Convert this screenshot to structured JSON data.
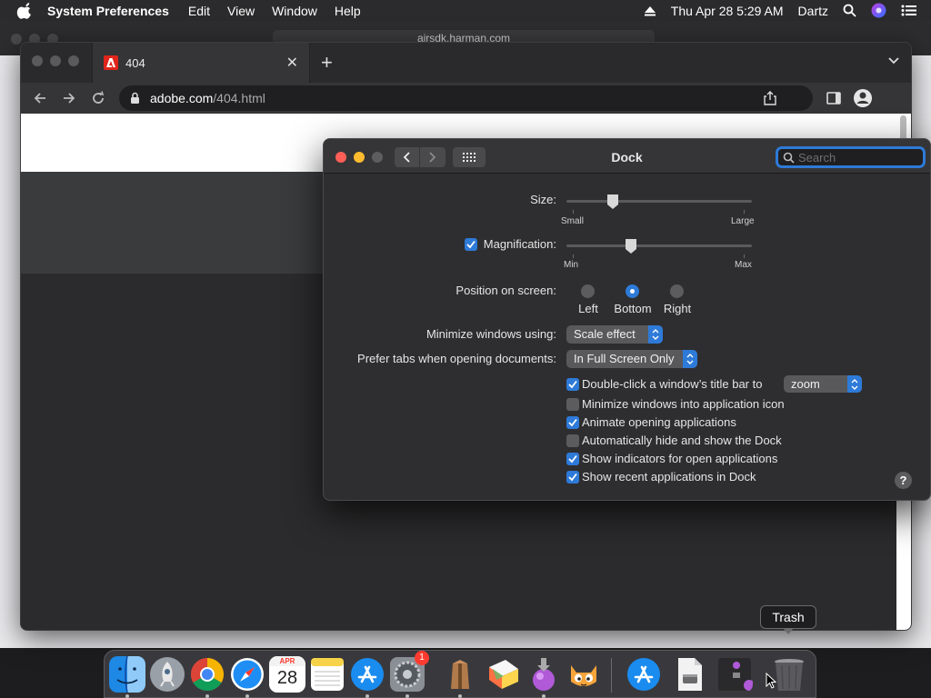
{
  "menubar": {
    "app_name": "System Preferences",
    "menus": [
      "Edit",
      "View",
      "Window",
      "Help"
    ],
    "date_time": "Thu Apr 28  5:29 AM",
    "user": "Dartz"
  },
  "background_window": {
    "url": "airsdk.harman.com"
  },
  "browser": {
    "tab_title": "404",
    "url_domain": "adobe.com",
    "url_path": "/404.html"
  },
  "dock_prefs": {
    "title": "Dock",
    "search_placeholder": "Search",
    "size_label": "Size:",
    "size_min": "Small",
    "size_max": "Large",
    "size_value": 0.25,
    "magnification_label": "Magnification:",
    "magnification_checked": true,
    "mag_min": "Min",
    "mag_max": "Max",
    "mag_value": 0.35,
    "position_label": "Position on screen:",
    "positions": [
      "Left",
      "Bottom",
      "Right"
    ],
    "position_selected": "Bottom",
    "minimize_label": "Minimize windows using:",
    "minimize_value": "Scale effect",
    "tabs_label": "Prefer tabs when opening documents:",
    "tabs_value": "In Full Screen Only",
    "checkboxes": [
      {
        "label": "Double-click a window’s title bar to",
        "checked": true
      },
      {
        "label": "Minimize windows into application icon",
        "checked": false
      },
      {
        "label": "Animate opening applications",
        "checked": true
      },
      {
        "label": "Automatically hide and show the Dock",
        "checked": false
      },
      {
        "label": "Show indicators for open applications",
        "checked": true
      },
      {
        "label": "Show recent applications in Dock",
        "checked": true
      }
    ],
    "double_click_action": "zoom",
    "help": "?"
  },
  "dock": {
    "tooltip": "Trash",
    "calendar_month": "APR",
    "calendar_day": "28",
    "settings_badge": "1",
    "apps": [
      "finder",
      "launchpad",
      "chrome",
      "safari",
      "calendar",
      "notes",
      "app-store",
      "system-preferences",
      "archive-utility",
      "color-picker",
      "installer",
      "scratch",
      "app-store-recent",
      "installer-disk",
      "script-editor",
      "trash"
    ]
  }
}
